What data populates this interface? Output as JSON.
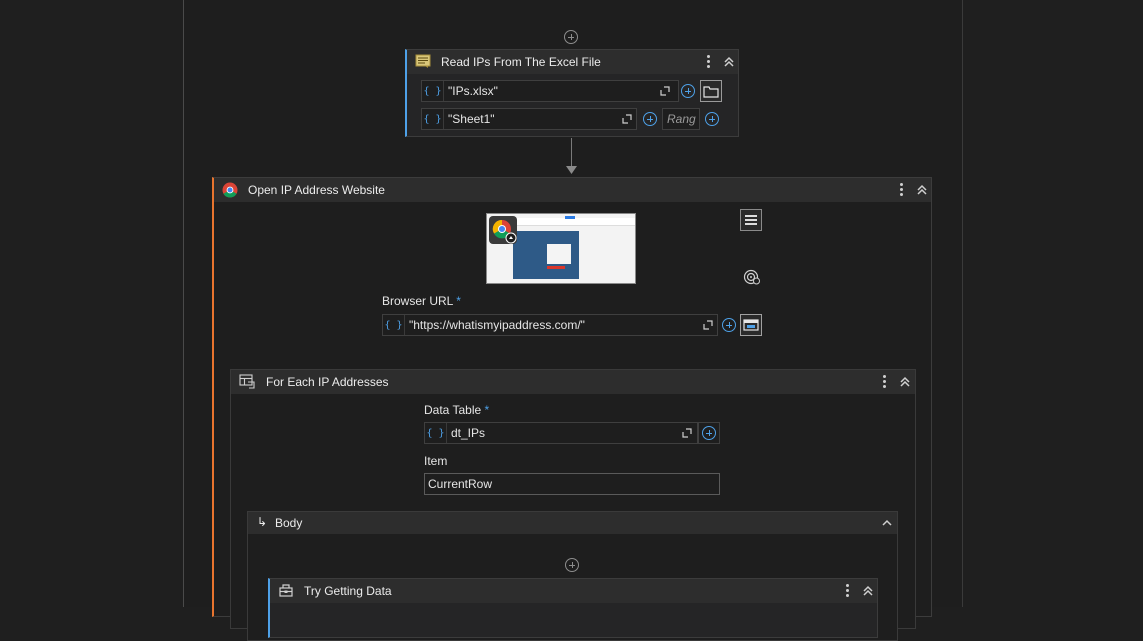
{
  "read_excel": {
    "title": "Read IPs From The Excel File",
    "workbook_value": "\"IPs.xlsx\"",
    "sheet_value": "\"Sheet1\"",
    "range_placeholder": "Rang"
  },
  "open_browser": {
    "title": "Open IP Address Website",
    "url_label": "Browser URL",
    "url_required": "*",
    "url_value": "\"https://whatismyipaddress.com/\""
  },
  "for_each": {
    "title": "For Each IP Addresses",
    "data_table_label": "Data Table",
    "data_table_required": "*",
    "data_table_value": "dt_IPs",
    "item_label": "Item",
    "item_value": "CurrentRow"
  },
  "body": {
    "title": "Body",
    "arrow": "↳"
  },
  "try_catch": {
    "title": "Try Getting Data"
  },
  "icons": {
    "excel": "excel-sheet-icon",
    "chrome": "chrome-icon",
    "foreach": "foreach-table-icon",
    "try": "try-catch-icon",
    "braces": "{ }"
  },
  "colors": {
    "accent_blue": "#4ea1e8",
    "accent_orange": "#e8742e",
    "background": "#1e1e1e"
  }
}
